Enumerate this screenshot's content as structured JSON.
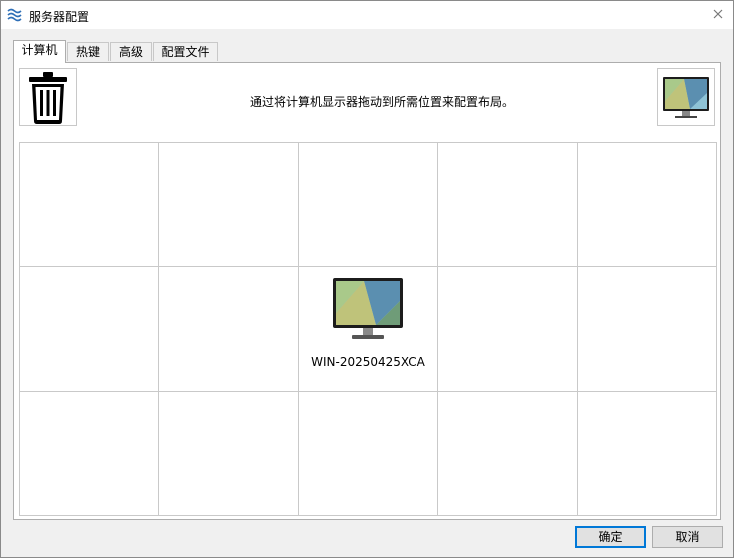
{
  "window": {
    "title": "服务器配置"
  },
  "tabs": [
    {
      "label": "计算机",
      "active": true
    },
    {
      "label": "热键",
      "active": false
    },
    {
      "label": "高级",
      "active": false
    },
    {
      "label": "配置文件",
      "active": false
    }
  ],
  "layout_panel": {
    "hint": "通过将计算机显示器拖动到所需位置来配置布局。"
  },
  "grid": {
    "computer_name": "WIN-20250425XCA"
  },
  "buttons": {
    "ok": "确定",
    "cancel": "取消"
  },
  "colors": {
    "accent": "#0078d7",
    "title_icon": "#2f6fb7"
  }
}
